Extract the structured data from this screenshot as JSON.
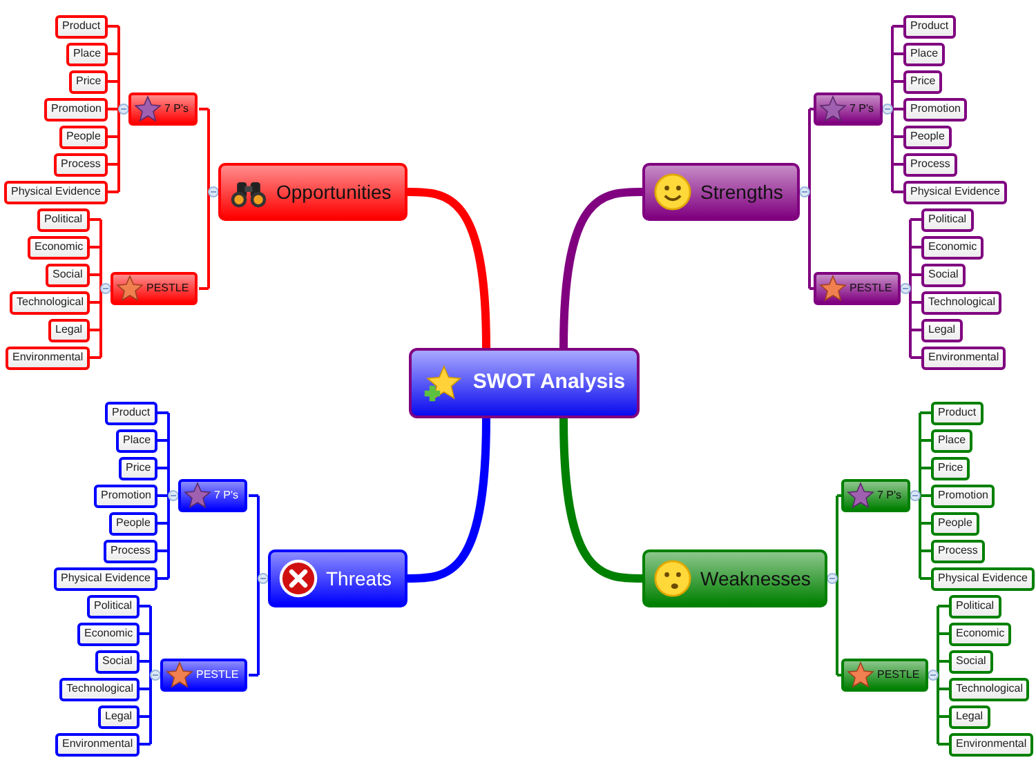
{
  "center": {
    "label": "SWOT Analysis"
  },
  "branches": [
    {
      "label": "Opportunities",
      "kind": "binoculars",
      "color": "#ff0000",
      "groups": [
        {
          "label": "7 P's",
          "kind": "purple-star",
          "items": [
            "Product",
            "Place",
            "Price",
            "Promotion",
            "People",
            "Process",
            "Physical Evidence"
          ]
        },
        {
          "label": "PESTLE",
          "kind": "orange-star",
          "items": [
            "Political",
            "Economic",
            "Social",
            "Technological",
            "Legal",
            "Environmental"
          ]
        }
      ]
    },
    {
      "label": "Strengths",
      "kind": "smiley",
      "color": "#800080",
      "groups": [
        {
          "label": "7 P's",
          "kind": "purple-star",
          "items": [
            "Product",
            "Place",
            "Price",
            "Promotion",
            "People",
            "Process",
            "Physical Evidence"
          ]
        },
        {
          "label": "PESTLE",
          "kind": "orange-star",
          "items": [
            "Political",
            "Economic",
            "Social",
            "Technological",
            "Legal",
            "Environmental"
          ]
        }
      ]
    },
    {
      "label": "Threats",
      "kind": "cross",
      "color": "#0000ff",
      "groups": [
        {
          "label": "7 P's",
          "kind": "purple-star",
          "items": [
            "Product",
            "Place",
            "Price",
            "Promotion",
            "People",
            "Process",
            "Physical Evidence"
          ]
        },
        {
          "label": "PESTLE",
          "kind": "orange-star",
          "items": [
            "Political",
            "Economic",
            "Social",
            "Technological",
            "Legal",
            "Environmental"
          ]
        }
      ]
    },
    {
      "label": "Weaknesses",
      "kind": "worried",
      "color": "#008000",
      "groups": [
        {
          "label": "7 P's",
          "kind": "purple-star",
          "items": [
            "Product",
            "Place",
            "Price",
            "Promotion",
            "People",
            "Process",
            "Physical Evidence"
          ]
        },
        {
          "label": "PESTLE",
          "kind": "orange-star",
          "items": [
            "Political",
            "Economic",
            "Social",
            "Technological",
            "Legal",
            "Environmental"
          ]
        }
      ]
    }
  ]
}
